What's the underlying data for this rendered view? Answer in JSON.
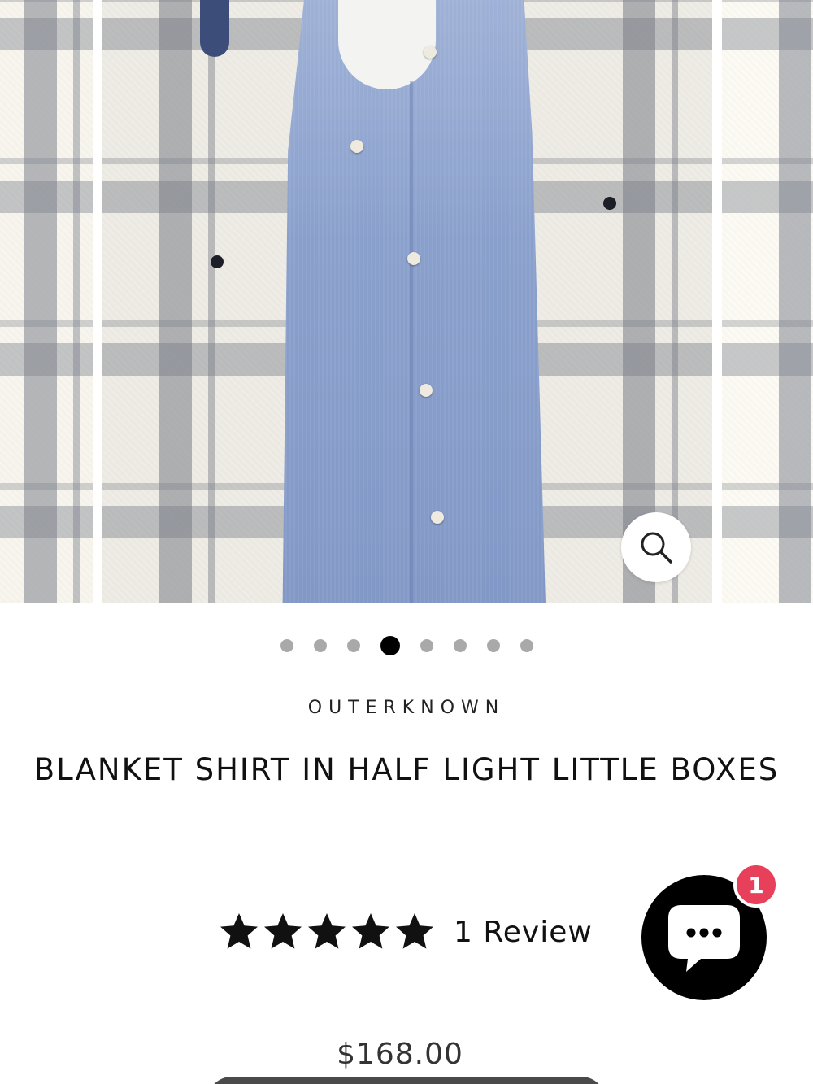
{
  "product": {
    "brand": "OUTERKNOWN",
    "title": "BLANKET SHIRT IN HALF LIGHT LITTLE BOXES",
    "price": "$168.00",
    "rating": 5,
    "review_count_label": "1 Review"
  },
  "carousel": {
    "slide_count": 8,
    "active_index": 3,
    "zoom_icon": "search-icon"
  },
  "chat": {
    "icon": "chat-bubble-icon",
    "badge_count": "1",
    "badge_color": "#e8405a"
  },
  "colors": {
    "accent": "#000000",
    "dot_inactive": "#a9a9a9",
    "text": "#111111"
  }
}
